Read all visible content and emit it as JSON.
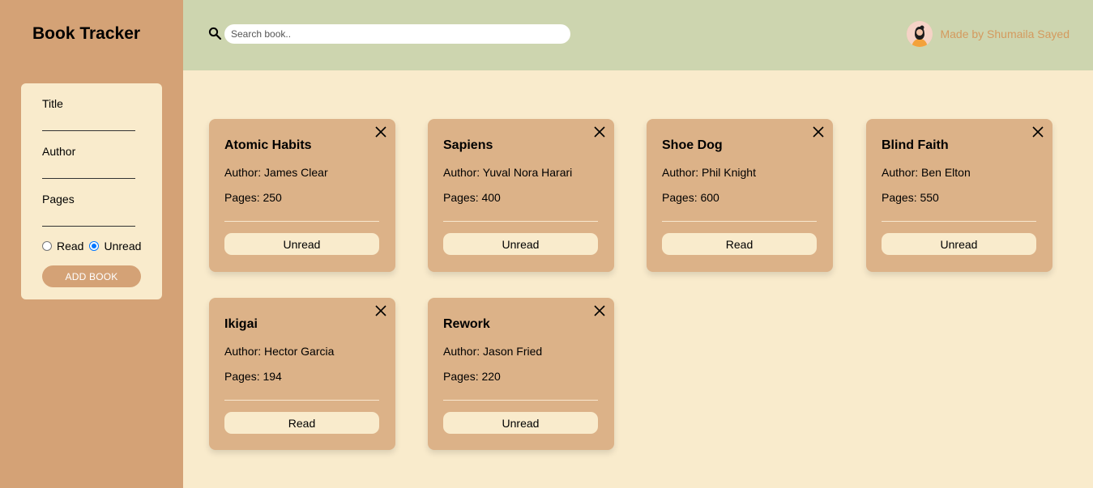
{
  "sidebar": {
    "title": "Book Tracker",
    "form": {
      "title_label": "Title",
      "author_label": "Author",
      "pages_label": "Pages",
      "read_label": "Read",
      "unread_label": "Unread",
      "selected_status": "Unread",
      "add_button": "ADD BOOK"
    }
  },
  "header": {
    "search_placeholder": "Search book..",
    "credit": "Made by Shumaila Sayed"
  },
  "books": [
    {
      "title": "Atomic Habits",
      "author": "Author: James Clear",
      "pages": "Pages: 250",
      "status": "Unread"
    },
    {
      "title": "Sapiens",
      "author": "Author: Yuval Nora Harari",
      "pages": "Pages: 400",
      "status": "Unread"
    },
    {
      "title": "Shoe Dog",
      "author": "Author: Phil Knight",
      "pages": "Pages: 600",
      "status": "Read"
    },
    {
      "title": "Blind Faith",
      "author": "Author: Ben Elton",
      "pages": "Pages: 550",
      "status": "Unread"
    },
    {
      "title": "Ikigai",
      "author": "Author: Hector Garcia",
      "pages": "Pages: 194",
      "status": "Read"
    },
    {
      "title": "Rework",
      "author": "Author: Jason Fried",
      "pages": "Pages: 220",
      "status": "Unread"
    }
  ],
  "colors": {
    "sidebar": "#d4a276",
    "topbar": "#cdd5af",
    "background": "#f9ebcc",
    "card": "#dcb288",
    "accent_text": "#d49a5e"
  }
}
